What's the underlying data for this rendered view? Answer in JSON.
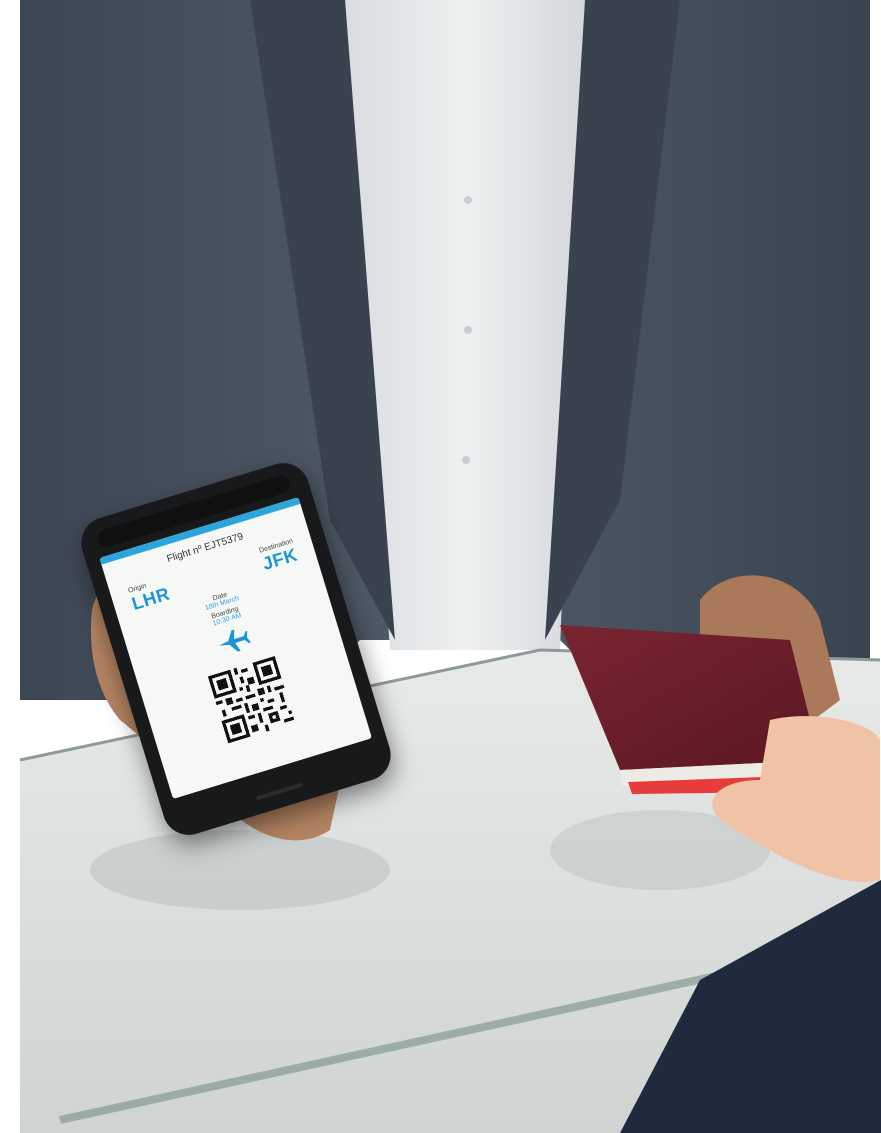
{
  "scene": {
    "description_colors": {
      "suit": "#4b5563",
      "shirt": "#e9ecef",
      "skin": "#b98563",
      "counter": "#dfe3e2",
      "passport": "#6e1f2b",
      "boarding_accent": "#1b95d6"
    }
  },
  "boarding_pass": {
    "flight_label": "Flight nº EJT5379",
    "origin_label": "Origin",
    "origin_code": "LHR",
    "destination_label": "Destination",
    "destination_code": "JFK",
    "date_label": "Date",
    "date_value": "18th March",
    "boarding_label": "Boarding",
    "boarding_value": "10:30 AM",
    "icons": [
      "airplane-icon",
      "qr-code-icon"
    ]
  }
}
